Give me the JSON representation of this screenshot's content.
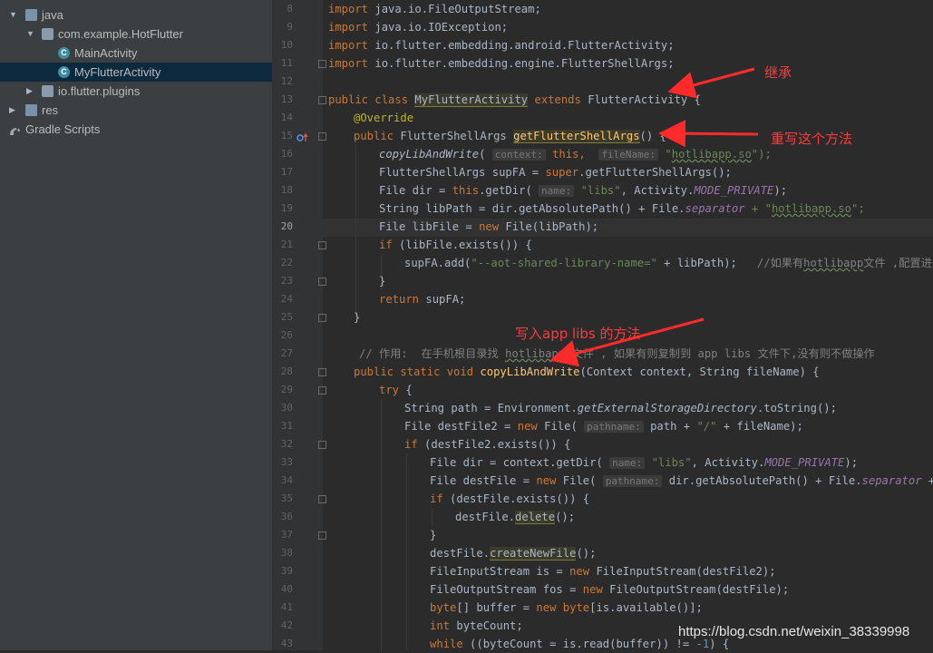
{
  "tree": [
    {
      "label": "java",
      "icon": "folder-icon",
      "arrow": "▼",
      "indent": 0
    },
    {
      "label": "com.example.HotFlutter",
      "icon": "package-icon",
      "arrow": "▼",
      "indent": 1
    },
    {
      "label": "MainActivity",
      "icon": "class-icon",
      "arrow": "",
      "indent": 2
    },
    {
      "label": "MyFlutterActivity",
      "icon": "class-icon",
      "arrow": "",
      "indent": 2,
      "selected": true
    },
    {
      "label": "io.flutter.plugins",
      "icon": "package-icon",
      "arrow": "▶",
      "indent": 1
    },
    {
      "label": "res",
      "icon": "folder-icon",
      "arrow": "▶",
      "indent": 0
    },
    {
      "label": "Gradle Scripts",
      "icon": "gradle-icon",
      "arrow": "",
      "indent": -1
    }
  ],
  "class_icon_letter": "C",
  "line_numbers": [
    "8",
    "9",
    "10",
    "11",
    "12",
    "13",
    "14",
    "15",
    "16",
    "17",
    "18",
    "19",
    "20",
    "21",
    "22",
    "23",
    "24",
    "25",
    "26",
    "27",
    "28",
    "29",
    "30",
    "31",
    "32",
    "33",
    "34",
    "35",
    "36",
    "37",
    "38",
    "39",
    "40",
    "41",
    "42",
    "43"
  ],
  "current_line": "20",
  "annotations": {
    "inherit": "继承",
    "override": "重写这个方法",
    "write": "写入app libs 的方法"
  },
  "watermark": "https://blog.csdn.net/weixin_38339998",
  "code": {
    "l8": [
      "import",
      " java.io.FileOutputStream;"
    ],
    "l9": [
      "import",
      " java.io.IOException;"
    ],
    "l10": [
      "import",
      " io.flutter.embedding.android.FlutterActivity;"
    ],
    "l11": [
      "import",
      " io.flutter.embedding.engine.FlutterShellArgs;"
    ],
    "l13": [
      "public class ",
      "MyFlutterActivity",
      " extends ",
      "FlutterActivity {"
    ],
    "l14": [
      "@Override"
    ],
    "l15": [
      "public ",
      "FlutterShellArgs ",
      "getFlutterShellArgs",
      "() {"
    ],
    "l16": [
      "copyLibAndWrite",
      "( ",
      "context:",
      " this,  ",
      "fileName:",
      " \"",
      "hotlibapp.so",
      "\");"
    ],
    "l17": [
      "FlutterShellArgs supFA = ",
      "super",
      ".getFlutterShellArgs();"
    ],
    "l18": [
      "File dir = ",
      "this",
      ".getDir( ",
      "name:",
      " \"libs\"",
      ", Activity.",
      "MODE_PRIVATE",
      ");"
    ],
    "l19": [
      "String libPath = dir.getAbsolutePath() + File.",
      "separator",
      " + \"",
      "hotlibapp.so",
      "\";"
    ],
    "l20": [
      "File libFile = ",
      "new ",
      "File(libPath);"
    ],
    "l21": [
      "if ",
      "(libFile.exists()) {"
    ],
    "l22": [
      "supFA.add(",
      "\"--aot-shared-library-name=\"",
      " + libPath);   ",
      "//如果有",
      "hotlibapp",
      "文件 ,配置进去,"
    ],
    "l23": [
      "}"
    ],
    "l24": [
      "return ",
      "supFA;"
    ],
    "l25": [
      "}"
    ],
    "l27": [
      "// 作用:  在手机根目录找 ",
      "hotlibapp",
      " 文件 , 如果有则复制到 app libs 文件下,没有则不做操作"
    ],
    "l28": [
      "public static void ",
      "copyLibAndWrite",
      "(Context context, String fileName) {"
    ],
    "l29": [
      "try ",
      "{"
    ],
    "l30": [
      "String path = Environment.",
      "getExternalStorageDirectory",
      ".toString();"
    ],
    "l31": [
      "File destFile2 = ",
      "new ",
      "File( ",
      "pathname:",
      " path + ",
      "\"/\"",
      " + fileName);"
    ],
    "l32": [
      "if ",
      "(destFile2.exists()) {"
    ],
    "l33": [
      "File dir = context.getDir( ",
      "name:",
      " \"libs\"",
      ", Activity.",
      "MODE_PRIVATE",
      ");"
    ],
    "l34": [
      "File destFile = ",
      "new ",
      "File( ",
      "pathname:",
      " dir.getAbsolutePath() + File.",
      "separator",
      " + fil"
    ],
    "l35": [
      "if ",
      "(destFile.exists()) {"
    ],
    "l36": [
      "destFile.",
      "delete",
      "();"
    ],
    "l37": [
      "}"
    ],
    "l38": [
      "destFile.",
      "createNewFile",
      "();"
    ],
    "l39": [
      "FileInputStream is = ",
      "new ",
      "FileInputStream(destFile2);"
    ],
    "l40": [
      "FileOutputStream fos = ",
      "new ",
      "FileOutputStream(destFile);"
    ],
    "l41": [
      "byte",
      "[] buffer = ",
      "new ",
      "byte",
      "[is.available()];"
    ],
    "l42": [
      "int ",
      "byteCount;"
    ],
    "l43": [
      "while ",
      "((byteCount = is.read(buffer)) != ",
      "-1",
      ") {"
    ]
  }
}
